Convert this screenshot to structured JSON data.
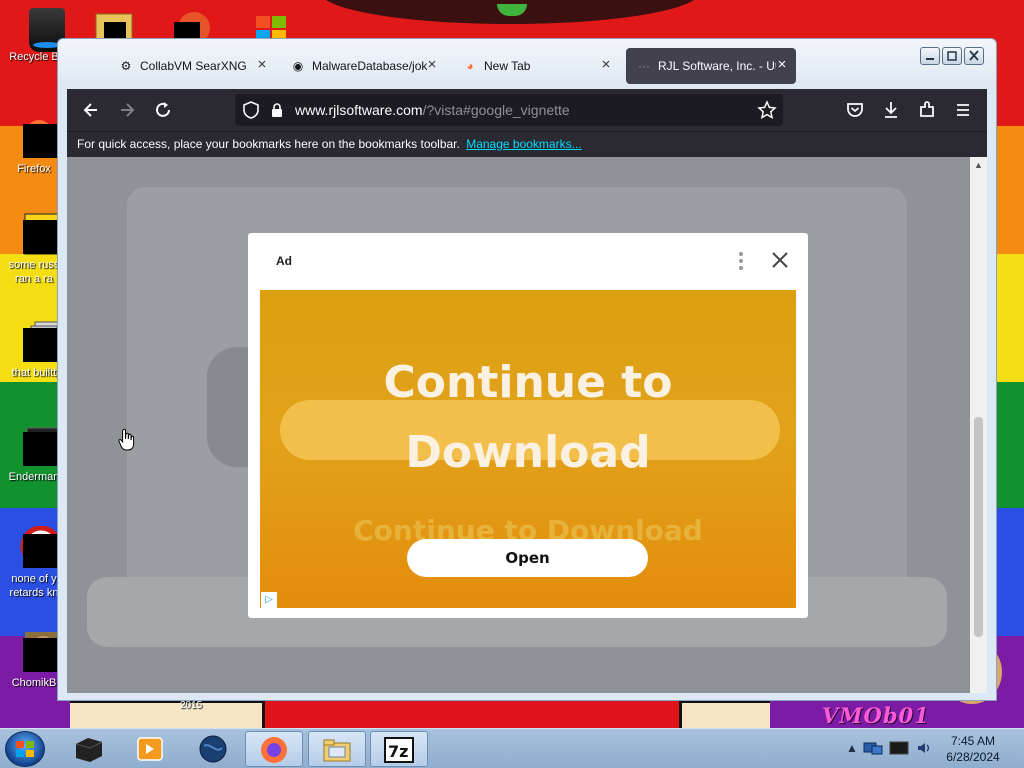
{
  "desktop": {
    "icons": [
      {
        "label": "Recycle B"
      },
      {
        "label": "Firefox"
      },
      {
        "label": "some russ",
        "label2": "ran a ra"
      },
      {
        "label": "that builtt"
      },
      {
        "label": "Enderman"
      },
      {
        "label": "none of y",
        "label2": "retards kn"
      },
      {
        "label": "ChomikB"
      }
    ],
    "wallpaper_text": "VMOb01",
    "wallpaper_year": "2015"
  },
  "browser": {
    "tabs": [
      {
        "label": "CollabVM SearXNG",
        "icon": "searxng-icon",
        "glyph": "⚙"
      },
      {
        "label": "MalwareDatabase/jok",
        "icon": "github-icon",
        "glyph": "◉"
      },
      {
        "label": "New Tab",
        "icon": "firefox-icon",
        "glyph": "◕"
      },
      {
        "label": "RJL Software, Inc. - Ut",
        "icon": "page-icon",
        "glyph": "···",
        "active": true
      }
    ],
    "close_glyph": "×",
    "url": {
      "host": "www.rjlsoftware.com",
      "path": "/?vista#google_vignette"
    },
    "bookmarks_bar": {
      "message": "For quick access, place your bookmarks here on the bookmarks toolbar.",
      "link": "Manage bookmarks..."
    },
    "ad": {
      "tag": "Ad",
      "headline_line1": "Continue to",
      "headline_line2": "Download",
      "ghost_text": "Continue to Download",
      "button": "Open",
      "choices_glyph": "▷"
    }
  },
  "taskbar": {
    "items": [
      {
        "name": "taskbar-item-cmd",
        "glyph": "▆"
      },
      {
        "name": "taskbar-item-media-player",
        "glyph": "▶"
      },
      {
        "name": "taskbar-item-globe",
        "glyph": "●"
      },
      {
        "name": "taskbar-item-firefox",
        "glyph": "◕",
        "active": true
      },
      {
        "name": "taskbar-item-explorer",
        "glyph": "▤"
      },
      {
        "name": "taskbar-item-7zip",
        "glyph": "7z"
      }
    ],
    "clock": {
      "time": "7:45 AM",
      "date": "6/28/2024"
    }
  },
  "colors": {
    "accent_link": "#00ddff",
    "ad_banner": "#e2a21c",
    "toolbar_dark": "#2b2a33"
  }
}
